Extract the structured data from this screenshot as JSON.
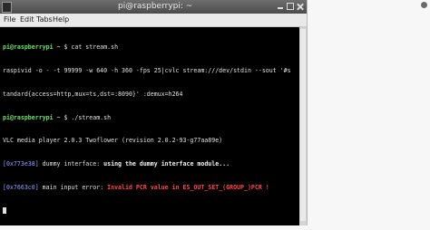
{
  "window": {
    "title": "pi@raspberrypi: ~",
    "menu": [
      "File",
      "Edit",
      "Tabs",
      "Help"
    ]
  },
  "terminal": {
    "line1": {
      "prompt": "pi@raspberrypi",
      "rest": " ~ $ cat stream.sh"
    },
    "line2": "raspivid -o - -t 99999 -w 640 -h 360 -fps 25|cvlc stream:///dev/stdin --sout '#s",
    "line3": "tandard{access=http,mux=ts,dst=:8090}' :demux=h264",
    "line4": {
      "prompt": "pi@raspberrypi",
      "rest": " ~ $ ./stream.sh"
    },
    "line5": "VLC media player 2.0.3 Twoflower (revision 2.0.2-93-g77aa89e)",
    "line6": {
      "addr": "[0x773e38]",
      "plain": " dummy interface: ",
      "bold": "using the dummy interface module..."
    },
    "line7": {
      "addr": "[0x7663c0]",
      "plain": " main input error: ",
      "error": "Invalid PCR value in ES_OUT_SET_(GROUP_)PCR !"
    }
  }
}
